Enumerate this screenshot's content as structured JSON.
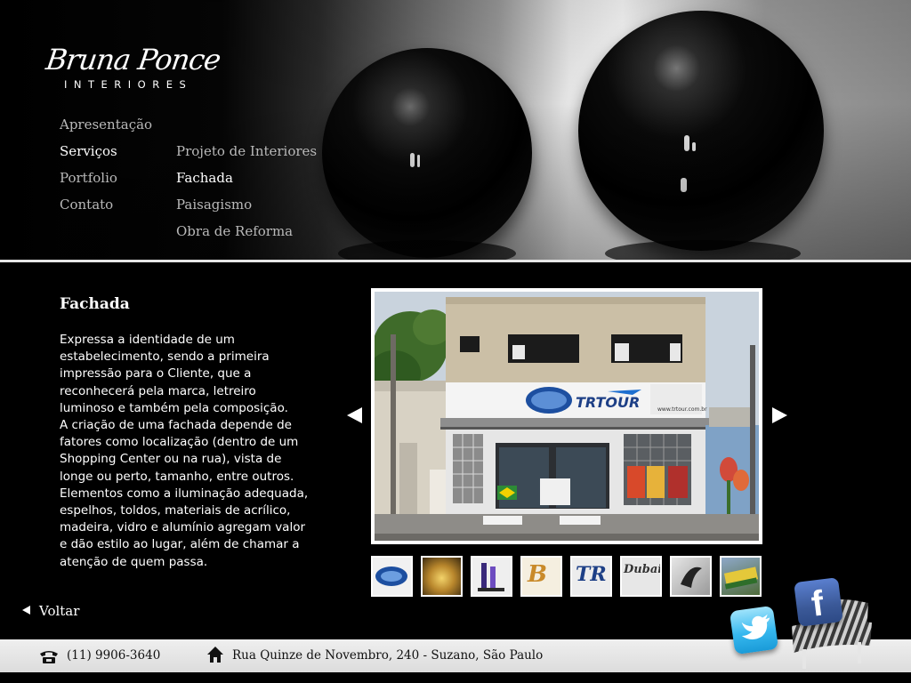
{
  "brand": {
    "script": "Bruna Ponce",
    "sub": "INTERIORES"
  },
  "nav": {
    "items": [
      {
        "label": "Apresentação",
        "active": false
      },
      {
        "label": "Serviços",
        "active": true
      },
      {
        "label": "Portfolio",
        "active": false
      },
      {
        "label": "Contato",
        "active": false
      }
    ],
    "subitems": [
      {
        "label": "Projeto de Interiores",
        "active": false
      },
      {
        "label": "Fachada",
        "active": true
      },
      {
        "label": "Paisagismo",
        "active": false
      },
      {
        "label": "Obra de Reforma",
        "active": false
      }
    ]
  },
  "content": {
    "title": "Fachada",
    "lines": [
      "Expressa a identidade de um",
      "estabelecimento, sendo a primeira",
      "impressão para o Cliente, que a",
      "reconhecerá pela marca, letreiro",
      "luminoso e também pela composição.",
      "A criação de uma fachada depende de",
      "fatores como localização (dentro de um",
      "Shopping Center ou na rua), vista de",
      "longe ou perto, tamanho, entre outros.",
      "Elementos como a iluminação adequada,",
      "espelhos, toldos, materiais de acrílico,",
      "madeira, vidro e alumínio agregam valor",
      "e dão estilo ao lugar, além de chamar a",
      "atenção de quem passa."
    ]
  },
  "photo": {
    "sign_text": "TRTOUR",
    "sign_site": "www.trtour.com.br"
  },
  "thumbnails": [
    {
      "text": ""
    },
    {
      "text": ""
    },
    {
      "text": ""
    },
    {
      "text": "B"
    },
    {
      "text": "TR"
    },
    {
      "text": "Dubai"
    },
    {
      "text": ""
    },
    {
      "text": ""
    }
  ],
  "back_label": "Voltar",
  "footer": {
    "phone": "(11) 9906-3640",
    "address": "Rua Quinze de Novembro, 240 - Suzano, São Paulo"
  },
  "social": {
    "facebook_glyph": "f"
  },
  "colors": {
    "background": "#000000",
    "nav_inactive": "#b9b9b9",
    "footer_bg": "#e6e6e6",
    "facebook": "#3b5998",
    "twitter": "#36b8ef"
  }
}
